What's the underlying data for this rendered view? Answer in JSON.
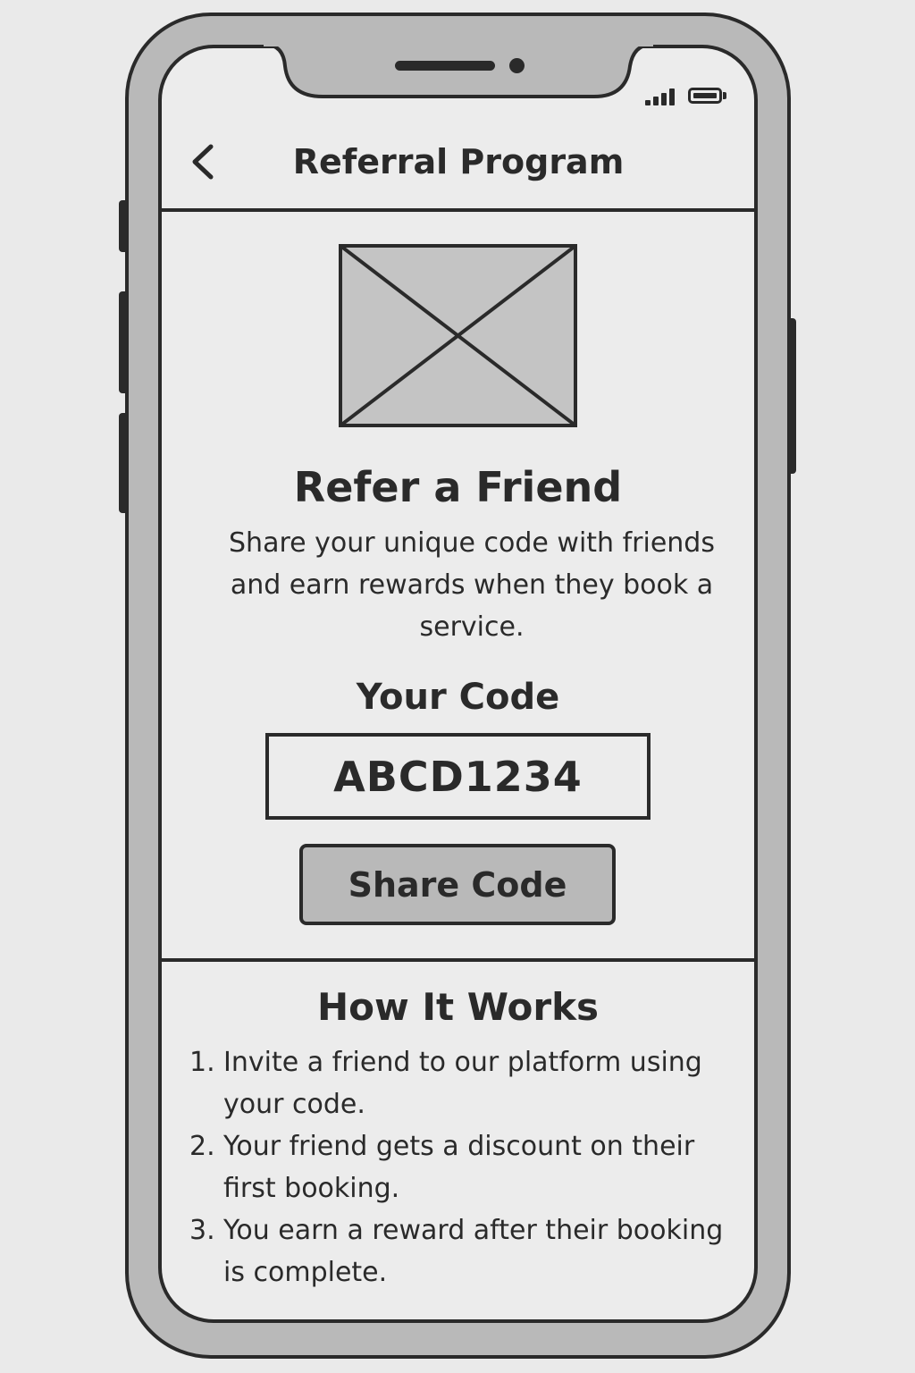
{
  "header": {
    "title": "Referral Program",
    "back_icon": "chevron-left-icon"
  },
  "status_bar": {
    "signal_icon": "signal-icon",
    "battery_icon": "battery-icon"
  },
  "hero": {
    "image_icon": "image-placeholder-icon"
  },
  "referral": {
    "title": "Refer a Friend",
    "description": "Share your unique code with friends and earn rewards when they book a service.",
    "code_label": "Your Code",
    "code": "ABCD1234",
    "share_label": "Share Code"
  },
  "how_it_works": {
    "title": "How It Works",
    "steps": [
      {
        "num": "1.",
        "text": "Invite a friend to our platform using your code."
      },
      {
        "num": "2.",
        "text": "Your friend gets a discount on their first booking."
      },
      {
        "num": "3.",
        "text": "You earn a reward after their booking is complete."
      }
    ]
  },
  "colors": {
    "ink": "#2a2a2a",
    "screen": "#ececec",
    "frame": "#b9b9b9",
    "background": "#eaeaea"
  }
}
